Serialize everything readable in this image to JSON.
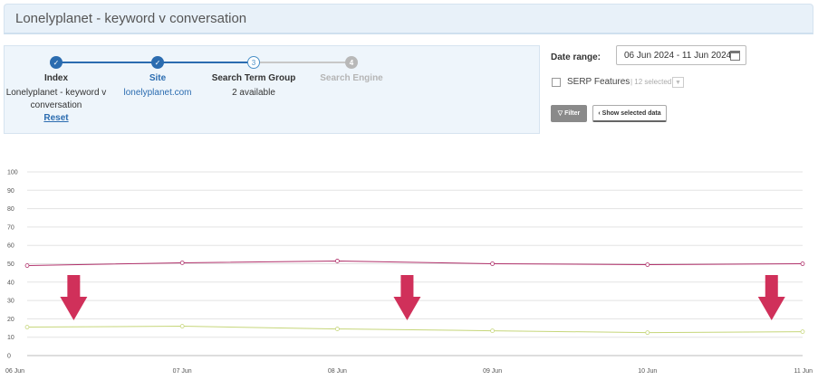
{
  "header": {
    "title": "Lonelyplanet - keyword v conversation"
  },
  "wizard": {
    "steps": [
      {
        "label": "Index",
        "sub": "Lonelyplanet - keyword v conversation",
        "action": "Reset",
        "state": "done",
        "icon": "check-icon"
      },
      {
        "label": "Site",
        "sub": "lonelyplanet.com",
        "state": "done",
        "icon": "check-icon"
      },
      {
        "label": "Search Term Group",
        "sub": "2 available",
        "state": "current",
        "number": "3"
      },
      {
        "label": "Search Engine",
        "state": "future",
        "number": "4"
      }
    ]
  },
  "filters": {
    "date_label": "Date range:",
    "date_value": "06 Jun 2024 - 11 Jun 2024",
    "serp_label": "SERP Features",
    "serp_count": "| 12 selected",
    "filter_button": "Filter",
    "show_button": "Show selected data"
  },
  "colors": {
    "series_1": "#b0306a",
    "series_2": "#c6d67a",
    "arrow": "#d0305a",
    "step_done": "#2b6cb0"
  },
  "chart_data": {
    "type": "line",
    "x": [
      "06 Jun",
      "07 Jun",
      "08 Jun",
      "09 Jun",
      "10 Jun",
      "11 Jun"
    ],
    "yticks": [
      0,
      10,
      20,
      30,
      40,
      50,
      60,
      70,
      80,
      90,
      100
    ],
    "ylim": [
      0,
      100
    ],
    "grid": true,
    "series": [
      {
        "values": [
          49,
          50.5,
          51.5,
          50,
          49.5,
          50
        ],
        "color": "#b0306a"
      },
      {
        "values": [
          15.5,
          16,
          14.5,
          13.5,
          12.5,
          13
        ],
        "color": "#c6d67a"
      }
    ],
    "annotations": [
      {
        "type": "down-arrow",
        "x": 0.3
      },
      {
        "type": "down-arrow",
        "x": 2.45
      },
      {
        "type": "down-arrow",
        "x": 4.8
      }
    ]
  }
}
